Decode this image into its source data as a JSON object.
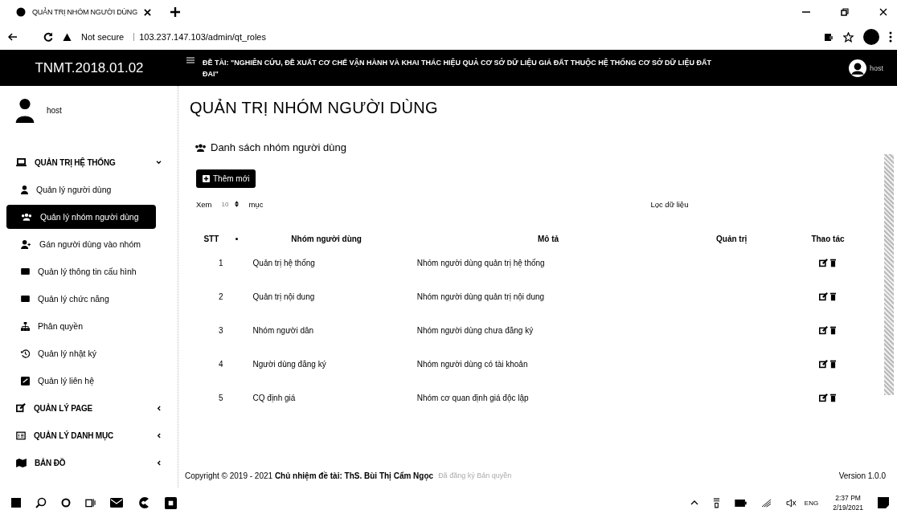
{
  "browser": {
    "tab_title": "QUẢN TRỊ NHÓM NGƯỜI DÙNG",
    "security": "Not secure",
    "url": "103.237.147.103/admin/qt_roles"
  },
  "header": {
    "brand": "TNMT.2018.01.02",
    "project_title": "ĐỀ TÀI: \"NGHIÊN CỨU, ĐỀ XUẤT CƠ CHẾ VẬN HÀNH VÀ KHAI THÁC HIỆU QUẢ CƠ SỞ DỮ LIỆU GIÁ ĐẤT THUỘC HỆ THỐNG CƠ SỞ DỮ LIỆU ĐẤT ĐAI\"",
    "user": "host"
  },
  "sidebar": {
    "user": "host",
    "sections": [
      {
        "label": "QUẢN TRỊ HỆ THỐNG",
        "expanded": true,
        "children": [
          {
            "label": "Quản lý người dùng",
            "selected": false
          },
          {
            "label": "Quản lý nhóm người dùng",
            "selected": true
          },
          {
            "label": "Gán người dùng vào nhóm",
            "selected": false
          },
          {
            "label": "Quản lý thông tin cấu hình",
            "selected": false
          },
          {
            "label": "Quản lý chức năng",
            "selected": false
          },
          {
            "label": "Phân quyền",
            "selected": false
          },
          {
            "label": "Quản lý nhật ký",
            "selected": false
          },
          {
            "label": "Quản lý liên hệ",
            "selected": false
          }
        ]
      },
      {
        "label": "QUẢN LÝ PAGE",
        "expanded": false
      },
      {
        "label": "QUẢN LÝ DANH MỤC",
        "expanded": false
      },
      {
        "label": "BẢN ĐỒ",
        "expanded": false
      }
    ]
  },
  "page": {
    "title": "QUẢN TRỊ NHÓM NGƯỜI DÙNG",
    "list_title": "Danh sách nhóm người dùng",
    "add_button": "Thêm mới",
    "show_label": "Xem",
    "page_size": "10",
    "show_suffix": "mục",
    "filter_label": "Lọc dữ liệu"
  },
  "table": {
    "columns": [
      "STT",
      "Nhóm người dùng",
      "Mô tả",
      "Quản trị",
      "Thao tác"
    ],
    "rows": [
      {
        "stt": "1",
        "name": "Quản trị hệ thống",
        "description": "Nhóm người dùng quản trị hệ thống"
      },
      {
        "stt": "2",
        "name": "Quản trị nội dung",
        "description": "Nhóm người dùng quản trị nội dung"
      },
      {
        "stt": "3",
        "name": "Nhóm người dân",
        "description": "Nhóm người dùng chưa đăng ký"
      },
      {
        "stt": "4",
        "name": "Người dùng đăng ký",
        "description": "Nhóm người dùng có tài khoản"
      },
      {
        "stt": "5",
        "name": "CQ định giá",
        "description": "Nhóm cơ quan định giá độc lập"
      }
    ]
  },
  "footer": {
    "copyright": "Copyright © 2019 - 2021 **Chủ nhiệm đề tài: ThS. Bùi Thị Cẩm Ngọc**",
    "rights": "Đã đăng ký Bản quyền",
    "version": "Version 1.0.0"
  },
  "taskbar": {
    "language": "ENG",
    "time": "2:37 PM",
    "date": "2/19/2021"
  }
}
